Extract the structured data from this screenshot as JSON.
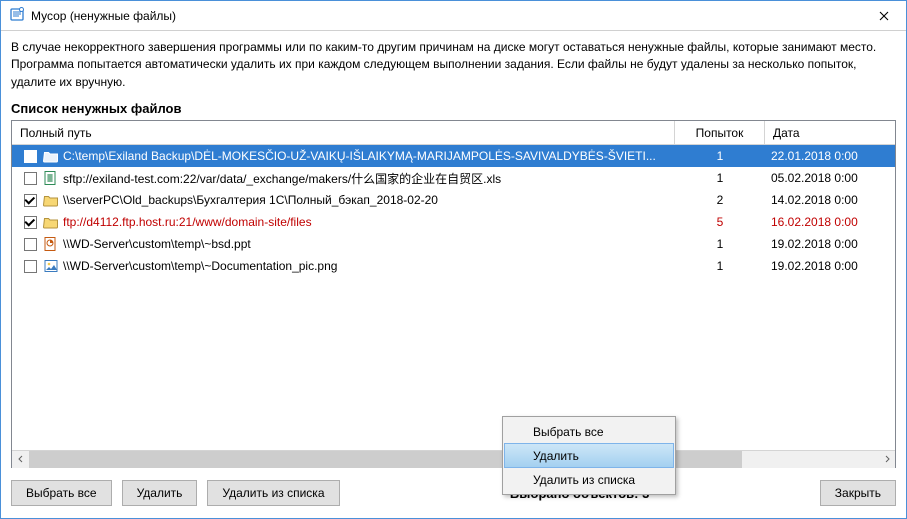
{
  "window": {
    "title": "Мусор (ненужные файлы)"
  },
  "intro": "В случае некорректного завершения программы или по каким-то другим причинам на диске могут оставаться ненужные файлы, которые занимают место. Программа попытается автоматически удалить их при каждом следующем выполнении задания. Если файлы не будут удалены за несколько попыток, удалите их вручную.",
  "listTitle": "Список ненужных файлов",
  "columns": {
    "path": "Полный путь",
    "attempts": "Попыток",
    "date": "Дата"
  },
  "rows": [
    {
      "checked": true,
      "selected": true,
      "error": false,
      "icon": "folder",
      "path": "C:\\temp\\Exiland Backup\\DĖL-MOKESČIO-UŽ-VAIKŲ-IŠLAIKYMĄ-MARIJAMPOLĖS-SAVIVALDYBĖS-ŠVIETI...",
      "attempts": "1",
      "date": "22.01.2018  0:00"
    },
    {
      "checked": false,
      "selected": false,
      "error": false,
      "icon": "xls",
      "path": "sftp://exiland-test.com:22/var/data/_exchange/makers/什么国家的企业在自贸区.xls",
      "attempts": "1",
      "date": "05.02.2018  0:00"
    },
    {
      "checked": true,
      "selected": false,
      "error": false,
      "icon": "folder",
      "path": "\\\\serverPC\\Old_backups\\Бухгалтерия 1С\\Полный_бэкап_2018-02-20",
      "attempts": "2",
      "date": "14.02.2018  0:00"
    },
    {
      "checked": true,
      "selected": false,
      "error": true,
      "icon": "folder",
      "path": "ftp://d4112.ftp.host.ru:21/www/domain-site/files",
      "attempts": "5",
      "date": "16.02.2018  0:00"
    },
    {
      "checked": false,
      "selected": false,
      "error": false,
      "icon": "ppt",
      "path": "\\\\WD-Server\\custom\\temp\\~bsd.ppt",
      "attempts": "1",
      "date": "19.02.2018  0:00"
    },
    {
      "checked": false,
      "selected": false,
      "error": false,
      "icon": "img",
      "path": "\\\\WD-Server\\custom\\temp\\~Documentation_pic.png",
      "attempts": "1",
      "date": "19.02.2018  0:00"
    }
  ],
  "contextMenu": {
    "selectAll": "Выбрать все",
    "delete": "Удалить",
    "removeFromList": "Удалить из списка"
  },
  "footer": {
    "selectAll": "Выбрать все",
    "delete": "Удалить",
    "removeFromList": "Удалить из списка",
    "status": "Выбрано объектов: 3",
    "close": "Закрыть"
  }
}
